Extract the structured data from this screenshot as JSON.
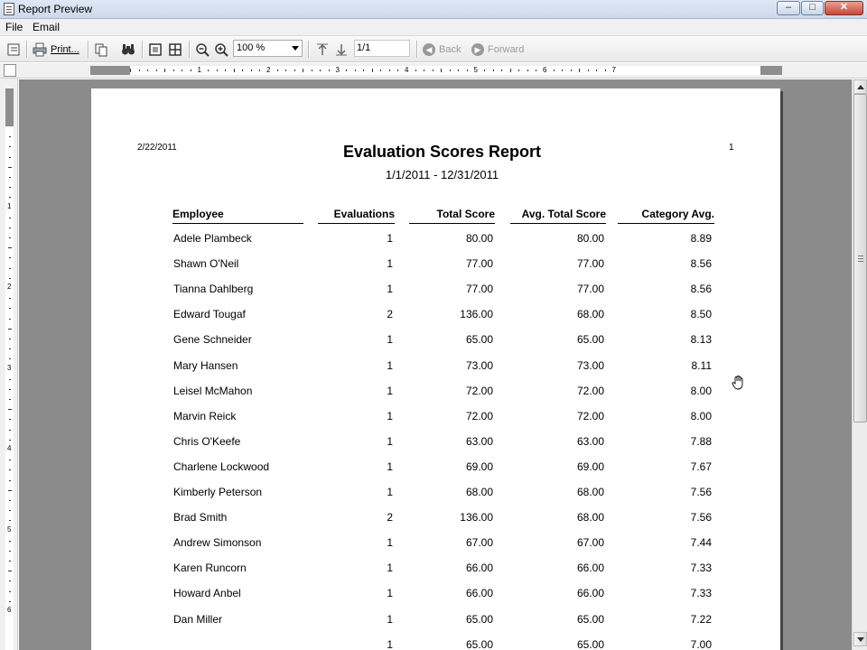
{
  "window": {
    "title": "Report Preview"
  },
  "menu": {
    "items": [
      "File",
      "Email"
    ]
  },
  "toolbar": {
    "print_label": "Print...",
    "zoom_value": "100 %",
    "page_value": "1/1",
    "back_label": "Back",
    "forward_label": "Forward"
  },
  "ruler": {
    "top_numbers": [
      "1",
      "2",
      "3",
      "4",
      "5",
      "6",
      "7"
    ],
    "left_numbers": [
      "1",
      "2",
      "3",
      "4",
      "5",
      "6"
    ]
  },
  "report": {
    "date": "2/22/2011",
    "page_number": "1",
    "title": "Evaluation Scores Report",
    "date_range": "1/1/2011 - 12/31/2011",
    "columns": [
      "Employee",
      "Evaluations",
      "Total Score",
      "Avg. Total Score",
      "Category Avg."
    ],
    "rows": [
      [
        "Adele Plambeck",
        "1",
        "80.00",
        "80.00",
        "8.89"
      ],
      [
        "Shawn O'Neil",
        "1",
        "77.00",
        "77.00",
        "8.56"
      ],
      [
        "Tianna Dahlberg",
        "1",
        "77.00",
        "77.00",
        "8.56"
      ],
      [
        "Edward Tougaf",
        "2",
        "136.00",
        "68.00",
        "8.50"
      ],
      [
        "Gene Schneider",
        "1",
        "65.00",
        "65.00",
        "8.13"
      ],
      [
        "Mary Hansen",
        "1",
        "73.00",
        "73.00",
        "8.11"
      ],
      [
        "Leisel McMahon",
        "1",
        "72.00",
        "72.00",
        "8.00"
      ],
      [
        "Marvin Reick",
        "1",
        "72.00",
        "72.00",
        "8.00"
      ],
      [
        "Chris O'Keefe",
        "1",
        "63.00",
        "63.00",
        "7.88"
      ],
      [
        "Charlene Lockwood",
        "1",
        "69.00",
        "69.00",
        "7.67"
      ],
      [
        "Kimberly Peterson",
        "1",
        "68.00",
        "68.00",
        "7.56"
      ],
      [
        "Brad Smith",
        "2",
        "136.00",
        "68.00",
        "7.56"
      ],
      [
        "Andrew Simonson",
        "1",
        "67.00",
        "67.00",
        "7.44"
      ],
      [
        "Karen Runcorn",
        "1",
        "66.00",
        "66.00",
        "7.33"
      ],
      [
        "Howard Anbel",
        "1",
        "66.00",
        "66.00",
        "7.33"
      ],
      [
        "Dan Miller",
        "1",
        "65.00",
        "65.00",
        "7.22"
      ],
      [
        "",
        "1",
        "65.00",
        "65.00",
        "7.00"
      ]
    ]
  },
  "icons": {
    "toolbar": [
      "table-of-contents-icon",
      "printer-icon",
      "copy-icon",
      "find-icon",
      "single-page-icon",
      "multi-page-icon",
      "zoom-out-icon",
      "zoom-in-icon",
      "page-up-icon",
      "page-down-icon",
      "back-icon",
      "forward-icon"
    ],
    "cursor": "hand-cursor-icon"
  }
}
